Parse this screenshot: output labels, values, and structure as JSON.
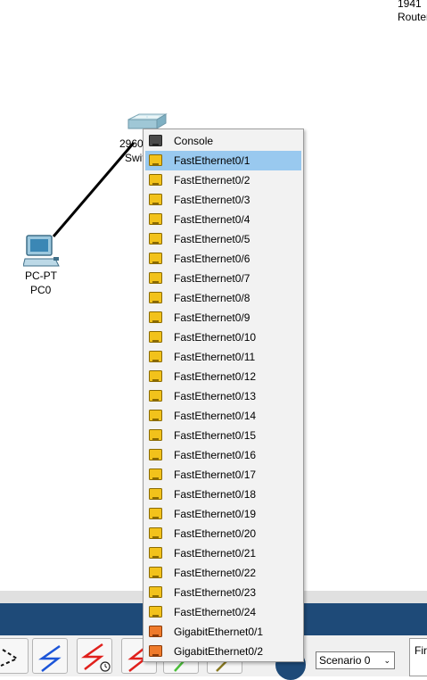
{
  "topology": {
    "router": {
      "model": "1941",
      "name": "Router"
    },
    "switch": {
      "model": "2960",
      "name": "Switch"
    },
    "pc": {
      "type": "PC-PT",
      "name": "PC0"
    }
  },
  "port_menu": {
    "items": [
      {
        "label": "Console",
        "kind": "console-port",
        "highlighted": false
      },
      {
        "label": "FastEthernet0/1",
        "kind": "fastethernet-port",
        "highlighted": true
      },
      {
        "label": "FastEthernet0/2",
        "kind": "fastethernet-port",
        "highlighted": false
      },
      {
        "label": "FastEthernet0/3",
        "kind": "fastethernet-port",
        "highlighted": false
      },
      {
        "label": "FastEthernet0/4",
        "kind": "fastethernet-port",
        "highlighted": false
      },
      {
        "label": "FastEthernet0/5",
        "kind": "fastethernet-port",
        "highlighted": false
      },
      {
        "label": "FastEthernet0/6",
        "kind": "fastethernet-port",
        "highlighted": false
      },
      {
        "label": "FastEthernet0/7",
        "kind": "fastethernet-port",
        "highlighted": false
      },
      {
        "label": "FastEthernet0/8",
        "kind": "fastethernet-port",
        "highlighted": false
      },
      {
        "label": "FastEthernet0/9",
        "kind": "fastethernet-port",
        "highlighted": false
      },
      {
        "label": "FastEthernet0/10",
        "kind": "fastethernet-port",
        "highlighted": false
      },
      {
        "label": "FastEthernet0/11",
        "kind": "fastethernet-port",
        "highlighted": false
      },
      {
        "label": "FastEthernet0/12",
        "kind": "fastethernet-port",
        "highlighted": false
      },
      {
        "label": "FastEthernet0/13",
        "kind": "fastethernet-port",
        "highlighted": false
      },
      {
        "label": "FastEthernet0/14",
        "kind": "fastethernet-port",
        "highlighted": false
      },
      {
        "label": "FastEthernet0/15",
        "kind": "fastethernet-port",
        "highlighted": false
      },
      {
        "label": "FastEthernet0/16",
        "kind": "fastethernet-port",
        "highlighted": false
      },
      {
        "label": "FastEthernet0/17",
        "kind": "fastethernet-port",
        "highlighted": false
      },
      {
        "label": "FastEthernet0/18",
        "kind": "fastethernet-port",
        "highlighted": false
      },
      {
        "label": "FastEthernet0/19",
        "kind": "fastethernet-port",
        "highlighted": false
      },
      {
        "label": "FastEthernet0/20",
        "kind": "fastethernet-port",
        "highlighted": false
      },
      {
        "label": "FastEthernet0/21",
        "kind": "fastethernet-port",
        "highlighted": false
      },
      {
        "label": "FastEthernet0/22",
        "kind": "fastethernet-port",
        "highlighted": false
      },
      {
        "label": "FastEthernet0/23",
        "kind": "fastethernet-port",
        "highlighted": false
      },
      {
        "label": "FastEthernet0/24",
        "kind": "fastethernet-port",
        "highlighted": false
      },
      {
        "label": "GigabitEthernet0/1",
        "kind": "gigabitethernet-port",
        "highlighted": false
      },
      {
        "label": "GigabitEthernet0/2",
        "kind": "gigabitethernet-port",
        "highlighted": false
      }
    ]
  },
  "bottom_toolbar": {
    "tools": [
      {
        "icon": "crossover-cable-icon"
      },
      {
        "icon": "copper-straight-through-icon"
      },
      {
        "icon": "timed-connection-icon"
      },
      {
        "icon": "serial-cable-icon"
      },
      {
        "icon": "green-cable-icon"
      },
      {
        "icon": "olive-cable-icon"
      }
    ],
    "scenario": {
      "selected": "Scenario 0"
    },
    "event_panel_label": "Fir"
  },
  "colors": {
    "highlight": "#99c9ef",
    "fastethernet_port": "#f2c21b",
    "gigabitethernet_port": "#ee7a2b",
    "console_port": "#4a4a4a",
    "toolbar_bar": "#1e4a78"
  }
}
